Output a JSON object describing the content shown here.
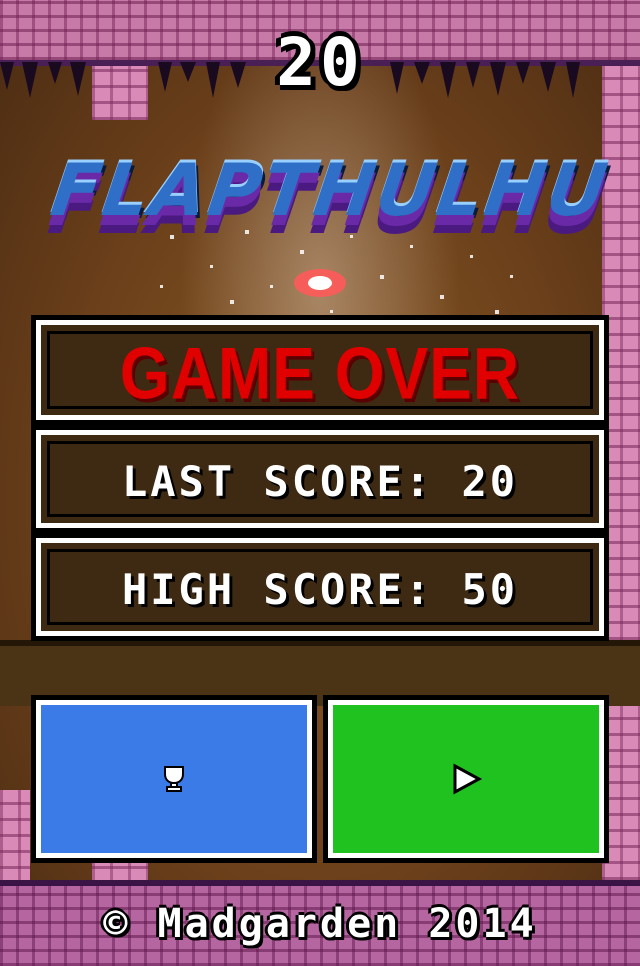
{
  "hud": {
    "score": "20"
  },
  "logo": {
    "title": "FLAPTHULHU"
  },
  "panels": {
    "game_over": "GAME OVER",
    "last_score_label": "LAST SCORE",
    "last_score_value": "20",
    "high_score_label": "HIGH SCORE",
    "high_score_value": "50"
  },
  "buttons": {
    "leaderboard": {
      "icon": "trophy-icon",
      "color": "#3a7be8"
    },
    "play": {
      "icon": "play-icon",
      "color": "#1fc21f"
    }
  },
  "footer": {
    "copyright": "© Madgarden 2014"
  },
  "colors": {
    "game_over_red": "#e00000",
    "panel_bg": "#3e2a12"
  }
}
